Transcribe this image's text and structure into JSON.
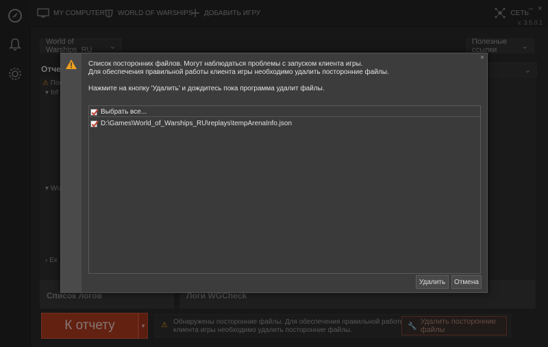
{
  "topbar": {
    "tab_my_computer": "MY COMPUTER",
    "tab_world_of_warships": "WORLD OF WARSHIPS",
    "tab_add_game": "ДОБАВИТЬ ИГРУ",
    "network": "СЕТЬ",
    "version": "v. 3.5.0.1"
  },
  "background": {
    "game_selector": "World of Warships_RU",
    "useful_links": "Полезные ссылки",
    "report_title": "Отчет",
    "line_warning": "Пос",
    "line_info": "Inf",
    "line_wo": "Wo",
    "line_ex": "Ex",
    "left_panel_title": "Список логов",
    "right_panel_title": "Логи WGCheck"
  },
  "bottom": {
    "report_button": "К отчету",
    "notice": "Обнаружены посторонние файлы. Для обеспечения правильной работы клиента игры необходимо удалить посторонние файлы.",
    "delete_foreign_button": "Удалить посторонние файлы"
  },
  "dialog": {
    "line1": "Список посторонних файлов. Могут наблюдаться проблемы с запуском клиента игры.",
    "line2": "Для обеспечения правильной работы клиента игры необходимо удалить посторонние файлы.",
    "hint": "Нажмите на кнопку 'Удалить' и дождитесь пока программа удалит файлы.",
    "select_all": "Выбрать все...",
    "file_path": "D:\\Games\\World_of_Warships_RU\\replays\\tempArenaInfo.json",
    "delete_button": "Удалить",
    "cancel_button": "Отмена",
    "close": "×"
  },
  "colors": {
    "accent_orange": "#b53c22",
    "warning_yellow": "#f0a01e",
    "checkbox_red": "#c0392b"
  }
}
